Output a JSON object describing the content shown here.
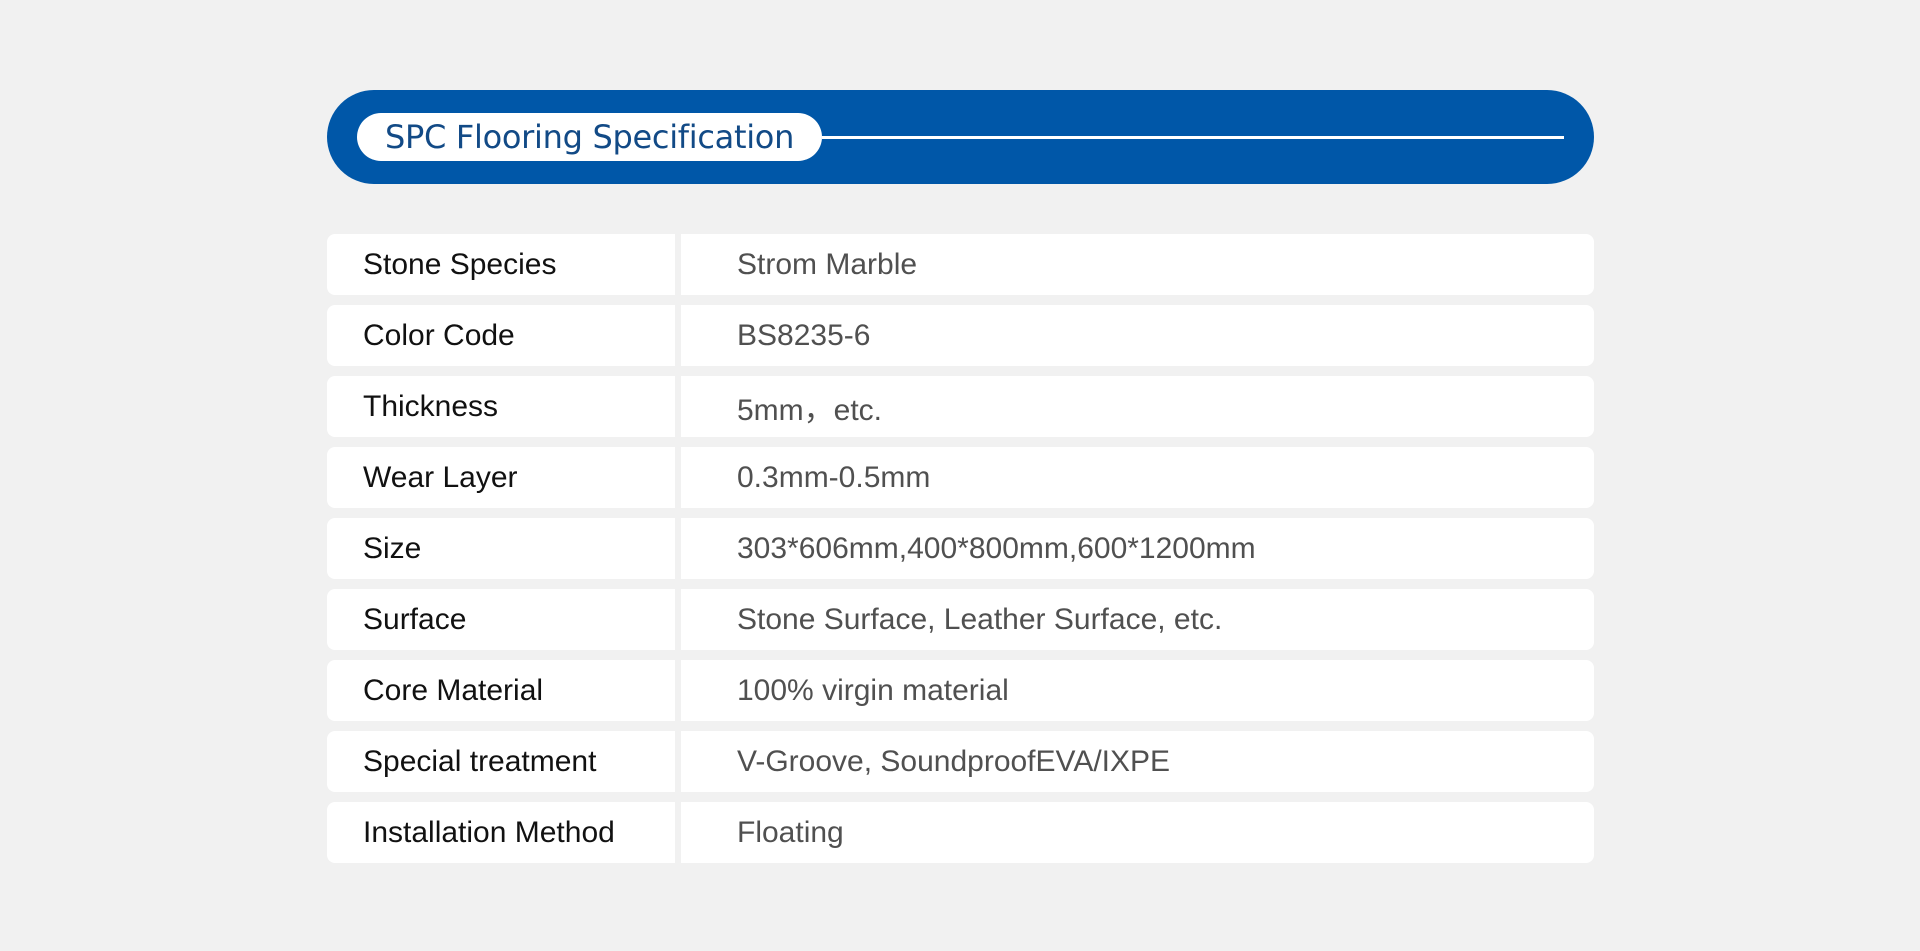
{
  "header": {
    "title": "SPC Flooring Specification"
  },
  "colors": {
    "brand_blue": "#0057a8",
    "title_text": "#124a86",
    "page_background": "#f1f1f1"
  },
  "specs": [
    {
      "label": "Stone Species",
      "value": "Strom Marble"
    },
    {
      "label": "Color Code",
      "value": "BS8235-6"
    },
    {
      "label": "Thickness",
      "value": "5mm，etc."
    },
    {
      "label": "Wear Layer",
      "value": "0.3mm-0.5mm"
    },
    {
      "label": "Size",
      "value": "303*606mm,400*800mm,600*1200mm"
    },
    {
      "label": "Surface",
      "value": "Stone Surface, Leather Surface, etc."
    },
    {
      "label": "Core Material",
      "value": "100% virgin material"
    },
    {
      "label": "Special treatment",
      "value": "V-Groove, SoundproofEVA/IXPE"
    },
    {
      "label": "Installation Method",
      "value": "Floating"
    }
  ]
}
